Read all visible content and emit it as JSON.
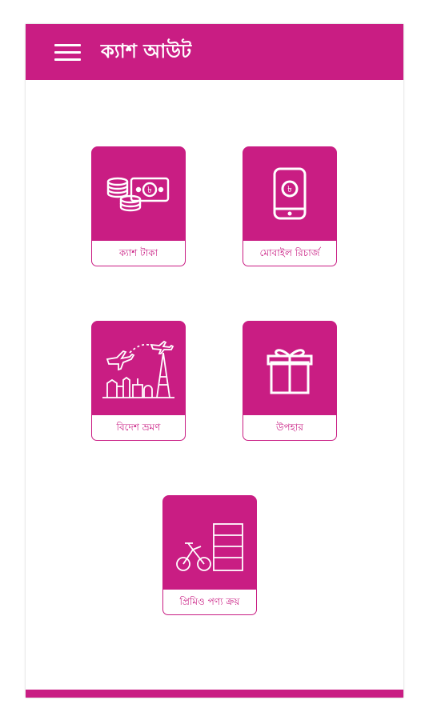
{
  "colors": {
    "accent": "#c91d83",
    "background": "#ffffff"
  },
  "appbar": {
    "title": "ক্যাশ আউট",
    "menu_icon": "hamburger-menu-icon"
  },
  "tiles": [
    {
      "label": "ক্যাশ টাকা",
      "icon": "cash-coins-icon"
    },
    {
      "label": "মোবাইল রিচার্জ",
      "icon": "mobile-taka-icon"
    },
    {
      "label": "বিদেশ ভ্রমণ",
      "icon": "travel-landmarks-icon"
    },
    {
      "label": "উপহার",
      "icon": "gift-box-icon"
    },
    {
      "label": "প্রিমিও পণ্য ক্রয়",
      "icon": "premium-products-icon"
    }
  ]
}
